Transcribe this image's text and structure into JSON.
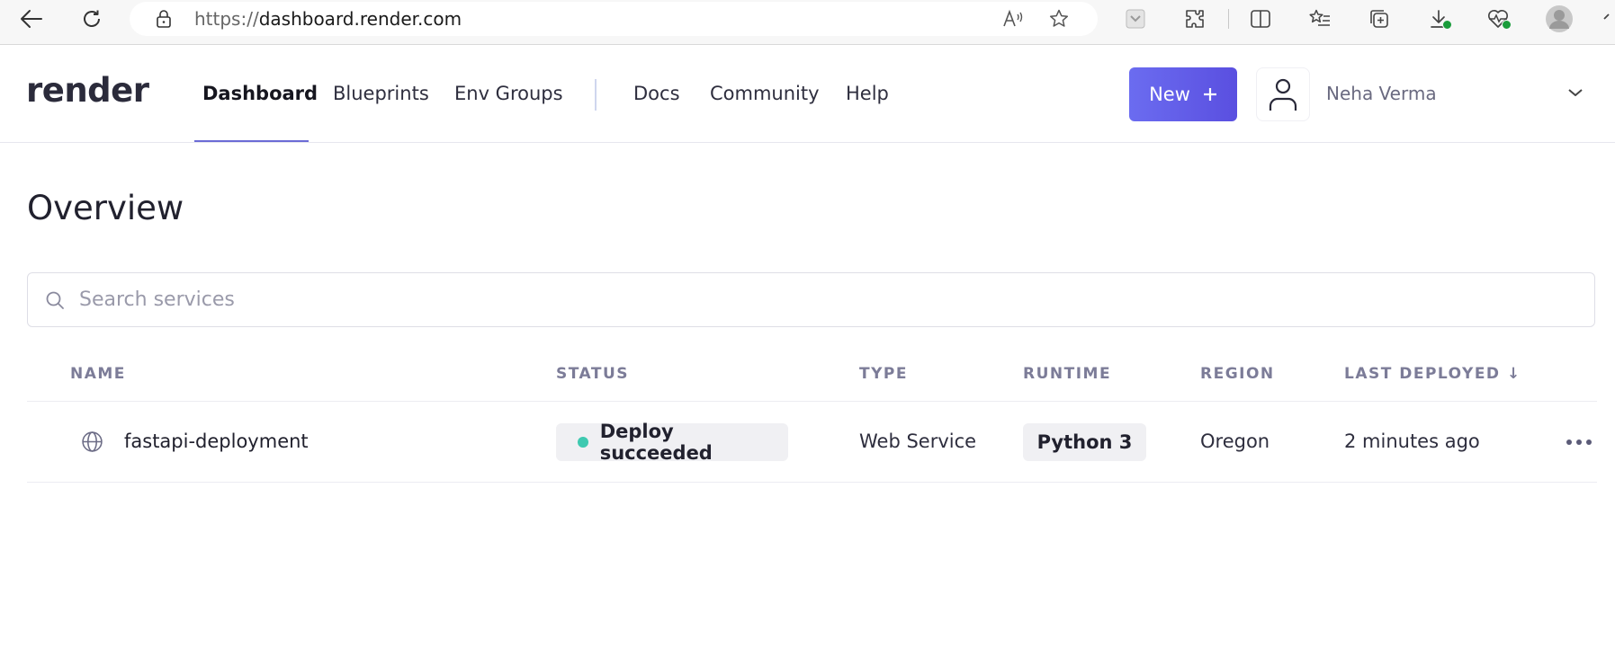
{
  "browser": {
    "url_prefix": "https://",
    "url_host": "dashboard.render.com"
  },
  "header": {
    "logo": "render",
    "nav": [
      {
        "label": "Dashboard",
        "active": true
      },
      {
        "label": "Blueprints",
        "active": false
      },
      {
        "label": "Env Groups",
        "active": false
      },
      {
        "label": "Docs",
        "active": false
      },
      {
        "label": "Community",
        "active": false
      },
      {
        "label": "Help",
        "active": false
      }
    ],
    "new_button": "New",
    "new_button_icon": "plus-icon",
    "user_name": "Neha Verma"
  },
  "page": {
    "title": "Overview",
    "search_placeholder": "Search services"
  },
  "table": {
    "headers": {
      "name": "NAME",
      "status": "STATUS",
      "type": "TYPE",
      "runtime": "RUNTIME",
      "region": "REGION",
      "last_deployed": "LAST DEPLOYED ↓"
    },
    "rows": [
      {
        "name": "fastapi-deployment",
        "icon": "globe-icon",
        "status": "Deploy succeeded",
        "status_color": "#3ec9b0",
        "type": "Web Service",
        "runtime": "Python 3",
        "region": "Oregon",
        "last_deployed": "2 minutes ago"
      }
    ]
  },
  "colors": {
    "accent": "#5a4fe0",
    "status_ok": "#3ec9b0"
  }
}
